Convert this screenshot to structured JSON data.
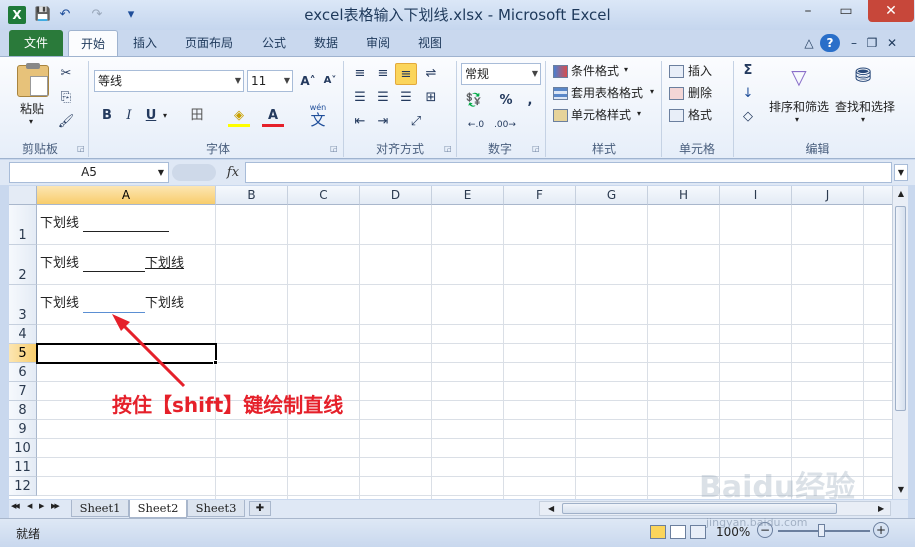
{
  "window": {
    "title": "excel表格输入下划线.xlsx - Microsoft Excel",
    "minimize": "–",
    "restore": "▭",
    "close": "✕"
  },
  "qat": {
    "save_icon": "💾",
    "undo_icon": "↶",
    "redo_icon": "↷",
    "customize_icon": "▾"
  },
  "tabs": [
    "文件",
    "开始",
    "插入",
    "页面布局",
    "公式",
    "数据",
    "审阅",
    "视图"
  ],
  "ribbon_right": {
    "minimize_ribbon": "△",
    "help": "?",
    "min": "–",
    "restore": "❐",
    "close": "✕"
  },
  "clipboard": {
    "paste": "粘贴",
    "cut": "✂",
    "copy": "⎘",
    "format_painter": "🖌",
    "label": "剪贴板"
  },
  "font": {
    "name": "等线",
    "size": "11",
    "grow": "A˄",
    "shrink": "A˅",
    "bold": "B",
    "italic": "I",
    "underline": "U",
    "border": "田",
    "fill": "◈",
    "color": "A",
    "wen": "wén",
    "wen_char": "文",
    "label": "字体"
  },
  "alignment": {
    "label": "对齐方式"
  },
  "number": {
    "format": "常规",
    "percent": "%",
    "comma": ",",
    "inc_dec": "←.0",
    "dec_dec": ".00→",
    "label": "数字"
  },
  "styles": {
    "conditional": "条件格式",
    "as_table": "套用表格格式",
    "cell_styles": "单元格样式",
    "label": "样式"
  },
  "cells": {
    "insert": "插入",
    "delete": "删除",
    "format": "格式",
    "label": "单元格"
  },
  "editing": {
    "sum": "Σ",
    "fill": "↓",
    "clear": "◇",
    "sort": "排序和筛选",
    "find": "查找和选择",
    "label": "编辑"
  },
  "formula_bar": {
    "name_box": "A5",
    "fx": "fx",
    "value": ""
  },
  "columns": [
    "A",
    "B",
    "C",
    "D",
    "E",
    "F",
    "G",
    "H",
    "I",
    "J"
  ],
  "rows": [
    "1",
    "2",
    "3",
    "4",
    "5",
    "6",
    "7",
    "8",
    "9",
    "10",
    "11",
    "12"
  ],
  "cells_content": {
    "A1": "下划线",
    "A2a": "下划线",
    "A2b": "下划线",
    "A3a": "下划线",
    "A3b": "下划线"
  },
  "annotation": "按住【shift】键绘制直线",
  "sheets": [
    "Sheet1",
    "Sheet2",
    "Sheet3"
  ],
  "active_sheet": "Sheet2",
  "sheet_nav": [
    "◀◀",
    "◀",
    "▶",
    "▶▶"
  ],
  "status": {
    "ready": "就绪",
    "zoom": "100%",
    "zoom_out": "−",
    "zoom_in": "+"
  },
  "watermark": "Baidu经验",
  "watermark_sub": "jingyan.baidu.com",
  "colors": {
    "accent_file": "#2a7a3a",
    "annotation": "#e5202a",
    "selected_header": "#f8cd6c"
  }
}
